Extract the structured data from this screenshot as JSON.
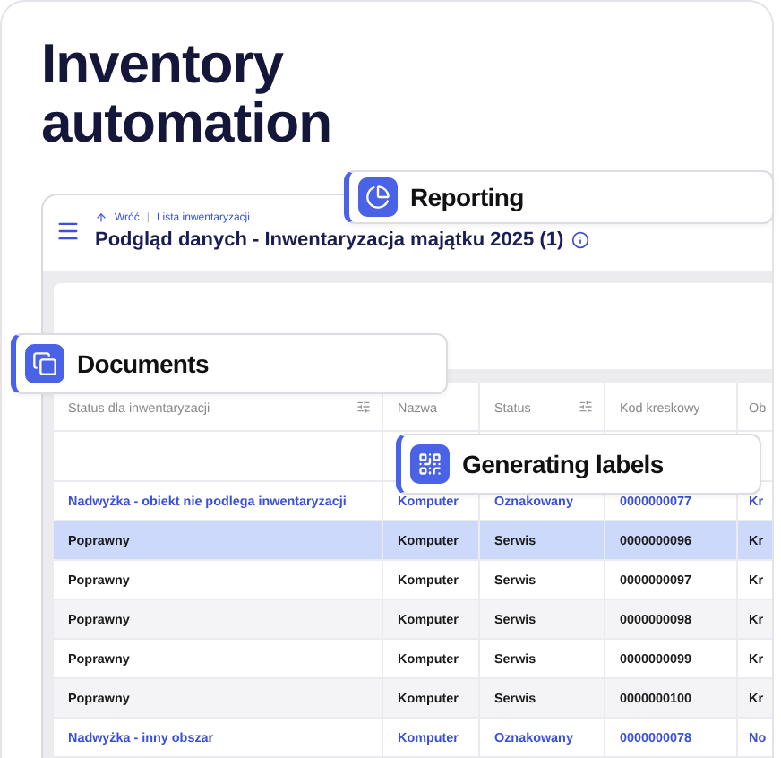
{
  "headline": "Inventory automation",
  "app": {
    "breadcrumb": {
      "back": "Wróć",
      "separator": "|",
      "current": "Lista inwentaryzacji"
    },
    "title": "Podgląd danych - Inwentaryzacja majątku 2025 (1)",
    "table": {
      "columns": [
        {
          "label": "Status dla inwentaryzacji",
          "filter": true
        },
        {
          "label": "Nazwa"
        },
        {
          "label": "Status",
          "filter": true
        },
        {
          "label": "Kod kreskowy"
        },
        {
          "label": "Ob"
        }
      ],
      "rows": [
        {
          "kind": "link",
          "selected": false,
          "cells": [
            "Nadwyżka - obiekt nie podlega inwentaryzacji",
            "Komputer",
            "Oznakowany",
            "0000000077",
            "Kr"
          ]
        },
        {
          "kind": "plain",
          "selected": true,
          "cells": [
            "Poprawny",
            "Komputer",
            "Serwis",
            "0000000096",
            "Kr"
          ]
        },
        {
          "kind": "plain",
          "selected": false,
          "cells": [
            "Poprawny",
            "Komputer",
            "Serwis",
            "0000000097",
            "Kr"
          ]
        },
        {
          "kind": "plain",
          "selected": false,
          "cells": [
            "Poprawny",
            "Komputer",
            "Serwis",
            "0000000098",
            "Kr"
          ]
        },
        {
          "kind": "plain",
          "selected": false,
          "cells": [
            "Poprawny",
            "Komputer",
            "Serwis",
            "0000000099",
            "Kr"
          ]
        },
        {
          "kind": "plain",
          "selected": false,
          "cells": [
            "Poprawny",
            "Komputer",
            "Serwis",
            "0000000100",
            "Kr"
          ]
        },
        {
          "kind": "link",
          "selected": false,
          "cells": [
            "Nadwyżka - inny obszar",
            "Komputer",
            "Oznakowany",
            "0000000078",
            "No"
          ]
        }
      ]
    }
  },
  "badges": [
    {
      "kind": "reporting",
      "label": "Reporting"
    },
    {
      "kind": "documents",
      "label": "Documents"
    },
    {
      "kind": "labels",
      "label": "Generating labels"
    }
  ]
}
